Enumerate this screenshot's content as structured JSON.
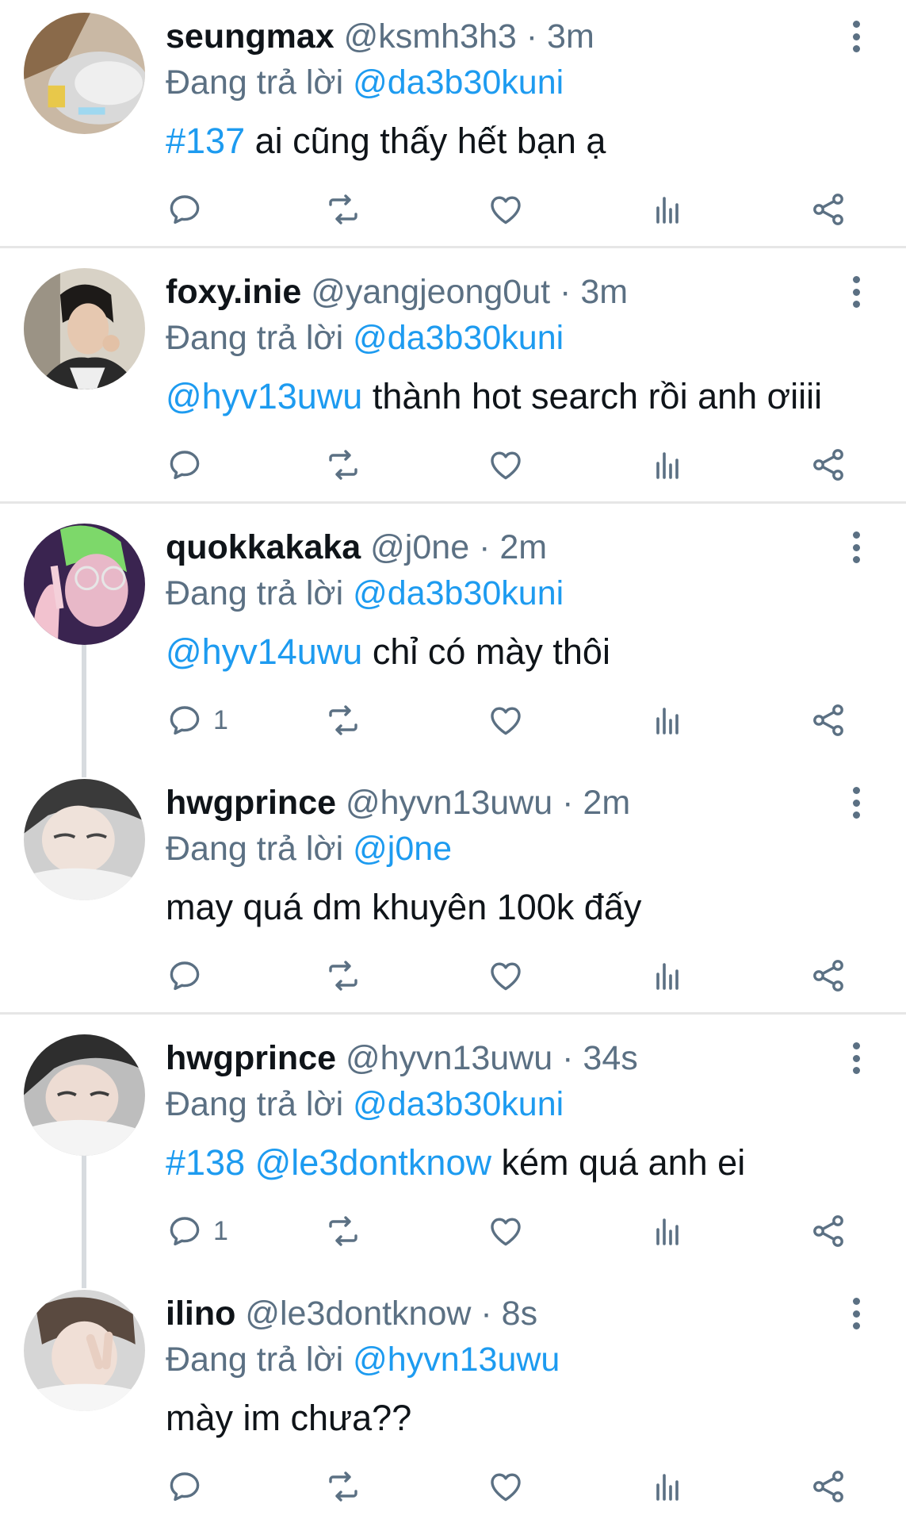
{
  "reply_prefix": "Đang trả lời",
  "separator": "·",
  "tweets": [
    {
      "name": "seungmax",
      "handle": "@ksmh3h3",
      "time": "3m",
      "reply_to": "@da3b30kuni",
      "body_mentions": "#137",
      "body_text": " ai cũng thấy hết bạn ạ",
      "reply_count": ""
    },
    {
      "name": "foxy.inie",
      "handle": "@yangjeong0ut",
      "time": "3m",
      "reply_to": "@da3b30kuni",
      "body_mentions": "@hyv13uwu",
      "body_text": " thành hot search rồi anh ơiiii",
      "reply_count": ""
    },
    {
      "name": "quokkakaka",
      "handle": "@j0ne",
      "time": "2m",
      "reply_to": "@da3b30kuni",
      "body_mentions": "@hyv14uwu",
      "body_text": " chỉ có mày thôi",
      "reply_count": "1"
    },
    {
      "name": "hwgprince",
      "handle": "@hyvn13uwu",
      "time": "2m",
      "reply_to": "@j0ne",
      "body_mentions": "",
      "body_text": "may quá dm khuyên 100k đấy",
      "reply_count": ""
    },
    {
      "name": "hwgprince",
      "handle": "@hyvn13uwu",
      "time": "34s",
      "reply_to": "@da3b30kuni",
      "body_mentions": "#138 @le3dontknow",
      "body_text": " kém quá anh ei",
      "reply_count": "1"
    },
    {
      "name": "ilino",
      "handle": "@le3dontknow",
      "time": "8s",
      "reply_to": "@hyvn13uwu",
      "body_mentions": "",
      "body_text": "mày im chưa??",
      "reply_count": ""
    }
  ],
  "colors": {
    "link": "#1d9bf0",
    "secondary_text": "#5b7083",
    "primary_text": "#0f1419",
    "divider": "#e6e6e6",
    "thread_line": "#d7dbdf"
  },
  "icons": [
    "reply-icon",
    "retweet-icon",
    "like-icon",
    "stats-icon",
    "share-icon",
    "more-icon"
  ]
}
